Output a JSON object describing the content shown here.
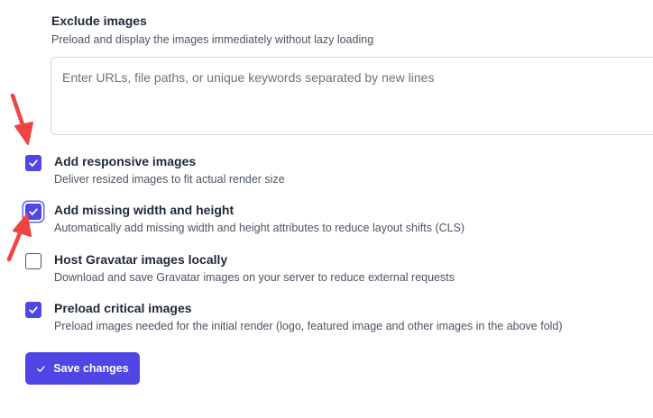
{
  "exclude_images": {
    "title": "Exclude images",
    "description": "Preload and display the images immediately without lazy loading",
    "placeholder": "Enter URLs, file paths, or unique keywords separated by new lines",
    "value": ""
  },
  "options": [
    {
      "title": "Add responsive images",
      "description": "Deliver resized images to fit actual render size",
      "checked": true
    },
    {
      "title": "Add missing width and height",
      "description": "Automatically add missing width and height attributes to reduce layout shifts (CLS)",
      "checked": true
    },
    {
      "title": "Host Gravatar images locally",
      "description": "Download and save Gravatar images on your server to reduce external requests",
      "checked": false
    },
    {
      "title": "Preload critical images",
      "description": "Preload images needed for the initial render (logo, featured image and other images in the above fold)",
      "checked": true
    }
  ],
  "save_button": {
    "label": "Save changes",
    "icon": "check-icon"
  },
  "annotations": {
    "arrow_color": "#ef4444"
  },
  "colors": {
    "accent": "#4f46e5"
  }
}
